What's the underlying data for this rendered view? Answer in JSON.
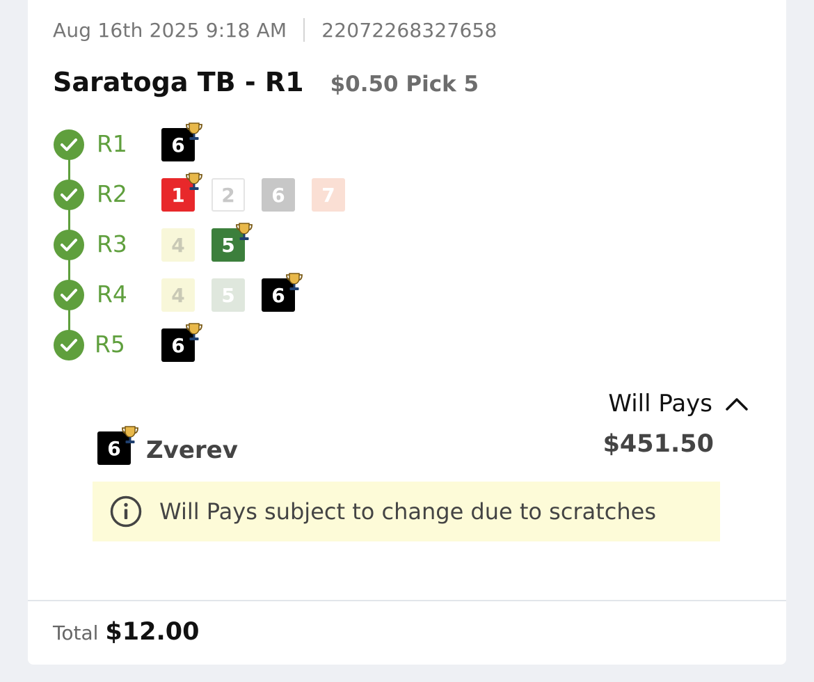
{
  "ticket": {
    "date": "Aug 16th 2025 9:18 AM",
    "ticket_id": "22072268327658",
    "track_race": "Saratoga TB - R1",
    "wager": "$0.50 Pick 5"
  },
  "legs": [
    {
      "label": "R1",
      "status": "won",
      "runners": [
        {
          "number": "6",
          "color": "#000000",
          "text": "#ffffff",
          "winner": true
        }
      ]
    },
    {
      "label": "R2",
      "status": "won",
      "runners": [
        {
          "number": "1",
          "color": "#e8282b",
          "text": "#ffffff",
          "winner": true
        },
        {
          "number": "2",
          "color": "#ffffff",
          "text": "#c8c8c8",
          "winner": false
        },
        {
          "number": "6",
          "color": "#c7c7c7",
          "text": "#ffffff",
          "winner": false
        },
        {
          "number": "7",
          "color": "#fadfd4",
          "text": "#ffffff",
          "winner": false
        }
      ]
    },
    {
      "label": "R3",
      "status": "won",
      "runners": [
        {
          "number": "4",
          "color": "#f8f7d9",
          "text": "#c9c9b6",
          "winner": false
        },
        {
          "number": "5",
          "color": "#3c7f3c",
          "text": "#ffffff",
          "winner": true
        }
      ]
    },
    {
      "label": "R4",
      "status": "won",
      "runners": [
        {
          "number": "4",
          "color": "#f8f7d9",
          "text": "#c9c9b6",
          "winner": false
        },
        {
          "number": "5",
          "color": "#dfe7dd",
          "text": "#ffffff",
          "winner": false
        },
        {
          "number": "6",
          "color": "#000000",
          "text": "#ffffff",
          "winner": true
        }
      ]
    },
    {
      "label": "R5",
      "status": "won",
      "runners": [
        {
          "number": "6",
          "color": "#000000",
          "text": "#ffffff",
          "winner": true
        }
      ]
    }
  ],
  "will_pays": {
    "label": "Will Pays",
    "runner_number": "6",
    "runner_name": "Zverev",
    "amount": "$451.50",
    "notice": "Will Pays subject to change due to scratches"
  },
  "total": {
    "label": "Total",
    "amount": "$12.00"
  },
  "colors": {
    "accent_green": "#5f9f3d",
    "notice_bg": "#fdfbd8"
  },
  "icons": {
    "leg_status": "check-circle-icon",
    "winner": "trophy-icon",
    "toggle": "chevron-up-icon",
    "notice": "info-icon"
  }
}
